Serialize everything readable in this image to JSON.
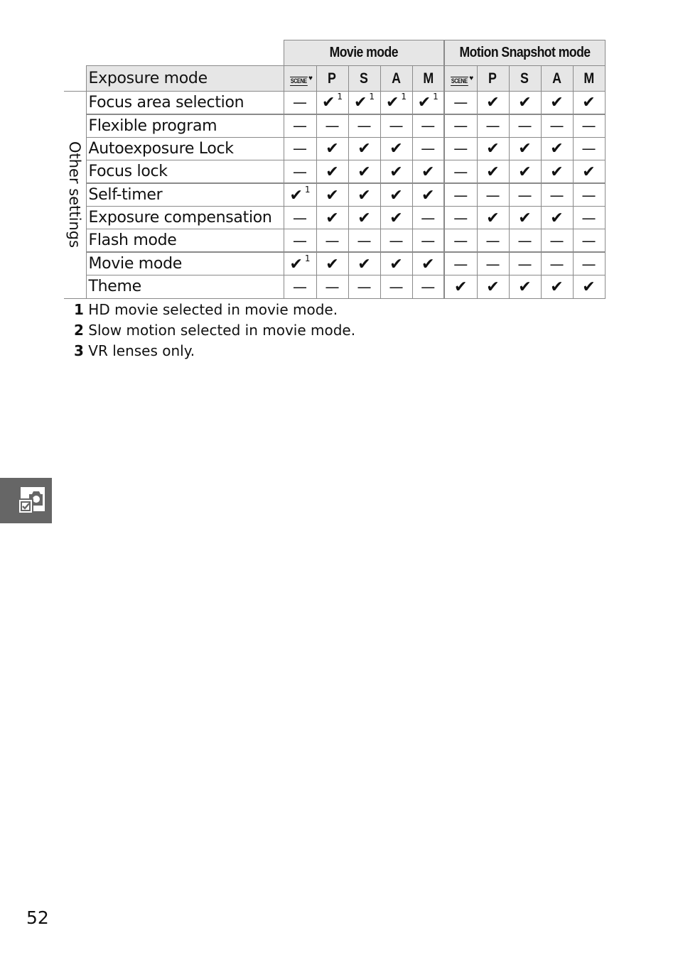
{
  "table": {
    "groups": [
      {
        "label": "Movie mode"
      },
      {
        "label": "Motion Snapshot mode"
      }
    ],
    "mode_row_label": "Exposure mode",
    "modes": [
      {
        "label": "SCENE",
        "icon": "scene-icon"
      },
      {
        "label": "P"
      },
      {
        "label": "S"
      },
      {
        "label": "A"
      },
      {
        "label": "M"
      },
      {
        "label": "SCENE",
        "icon": "scene-icon"
      },
      {
        "label": "P"
      },
      {
        "label": "S"
      },
      {
        "label": "A"
      },
      {
        "label": "M"
      }
    ],
    "side_label": "Other settings",
    "check_symbol": "✔",
    "dash_symbol": "—",
    "rows": [
      {
        "label": "Focus area selection",
        "cells": [
          "—",
          "✔1",
          "✔1",
          "✔1",
          "✔1",
          "—",
          "✔",
          "✔",
          "✔",
          "✔"
        ]
      },
      {
        "label": "Flexible program",
        "cells": [
          "—",
          "—",
          "—",
          "—",
          "—",
          "—",
          "—",
          "—",
          "—",
          "—"
        ]
      },
      {
        "label": "Autoexposure Lock",
        "cells": [
          "—",
          "✔",
          "✔",
          "✔",
          "—",
          "—",
          "✔",
          "✔",
          "✔",
          "—"
        ]
      },
      {
        "label": "Focus lock",
        "cells": [
          "—",
          "✔",
          "✔",
          "✔",
          "✔",
          "—",
          "✔",
          "✔",
          "✔",
          "✔"
        ]
      },
      {
        "label": "Self-timer",
        "cells": [
          "✔1",
          "✔",
          "✔",
          "✔",
          "✔",
          "—",
          "—",
          "—",
          "—",
          "—"
        ]
      },
      {
        "label": "Exposure compensation",
        "cells": [
          "—",
          "✔",
          "✔",
          "✔",
          "—",
          "—",
          "✔",
          "✔",
          "✔",
          "—"
        ]
      },
      {
        "label": "Flash mode",
        "cells": [
          "—",
          "—",
          "—",
          "—",
          "—",
          "—",
          "—",
          "—",
          "—",
          "—"
        ]
      },
      {
        "label": "Movie mode",
        "cells": [
          "✔1",
          "✔",
          "✔",
          "✔",
          "✔",
          "—",
          "—",
          "—",
          "—",
          "—"
        ]
      },
      {
        "label": "Theme",
        "cells": [
          "—",
          "—",
          "—",
          "—",
          "—",
          "✔",
          "✔",
          "✔",
          "✔",
          "✔"
        ]
      }
    ]
  },
  "footnotes": [
    {
      "num": "1",
      "text": "HD movie selected in movie mode."
    },
    {
      "num": "2",
      "text": "Slow motion selected in movie mode."
    },
    {
      "num": "3",
      "text": "VR lenses only."
    }
  ],
  "side_tab": {
    "icon": "camera-checkbox-icon",
    "color": "#666666"
  },
  "page_number": "52"
}
